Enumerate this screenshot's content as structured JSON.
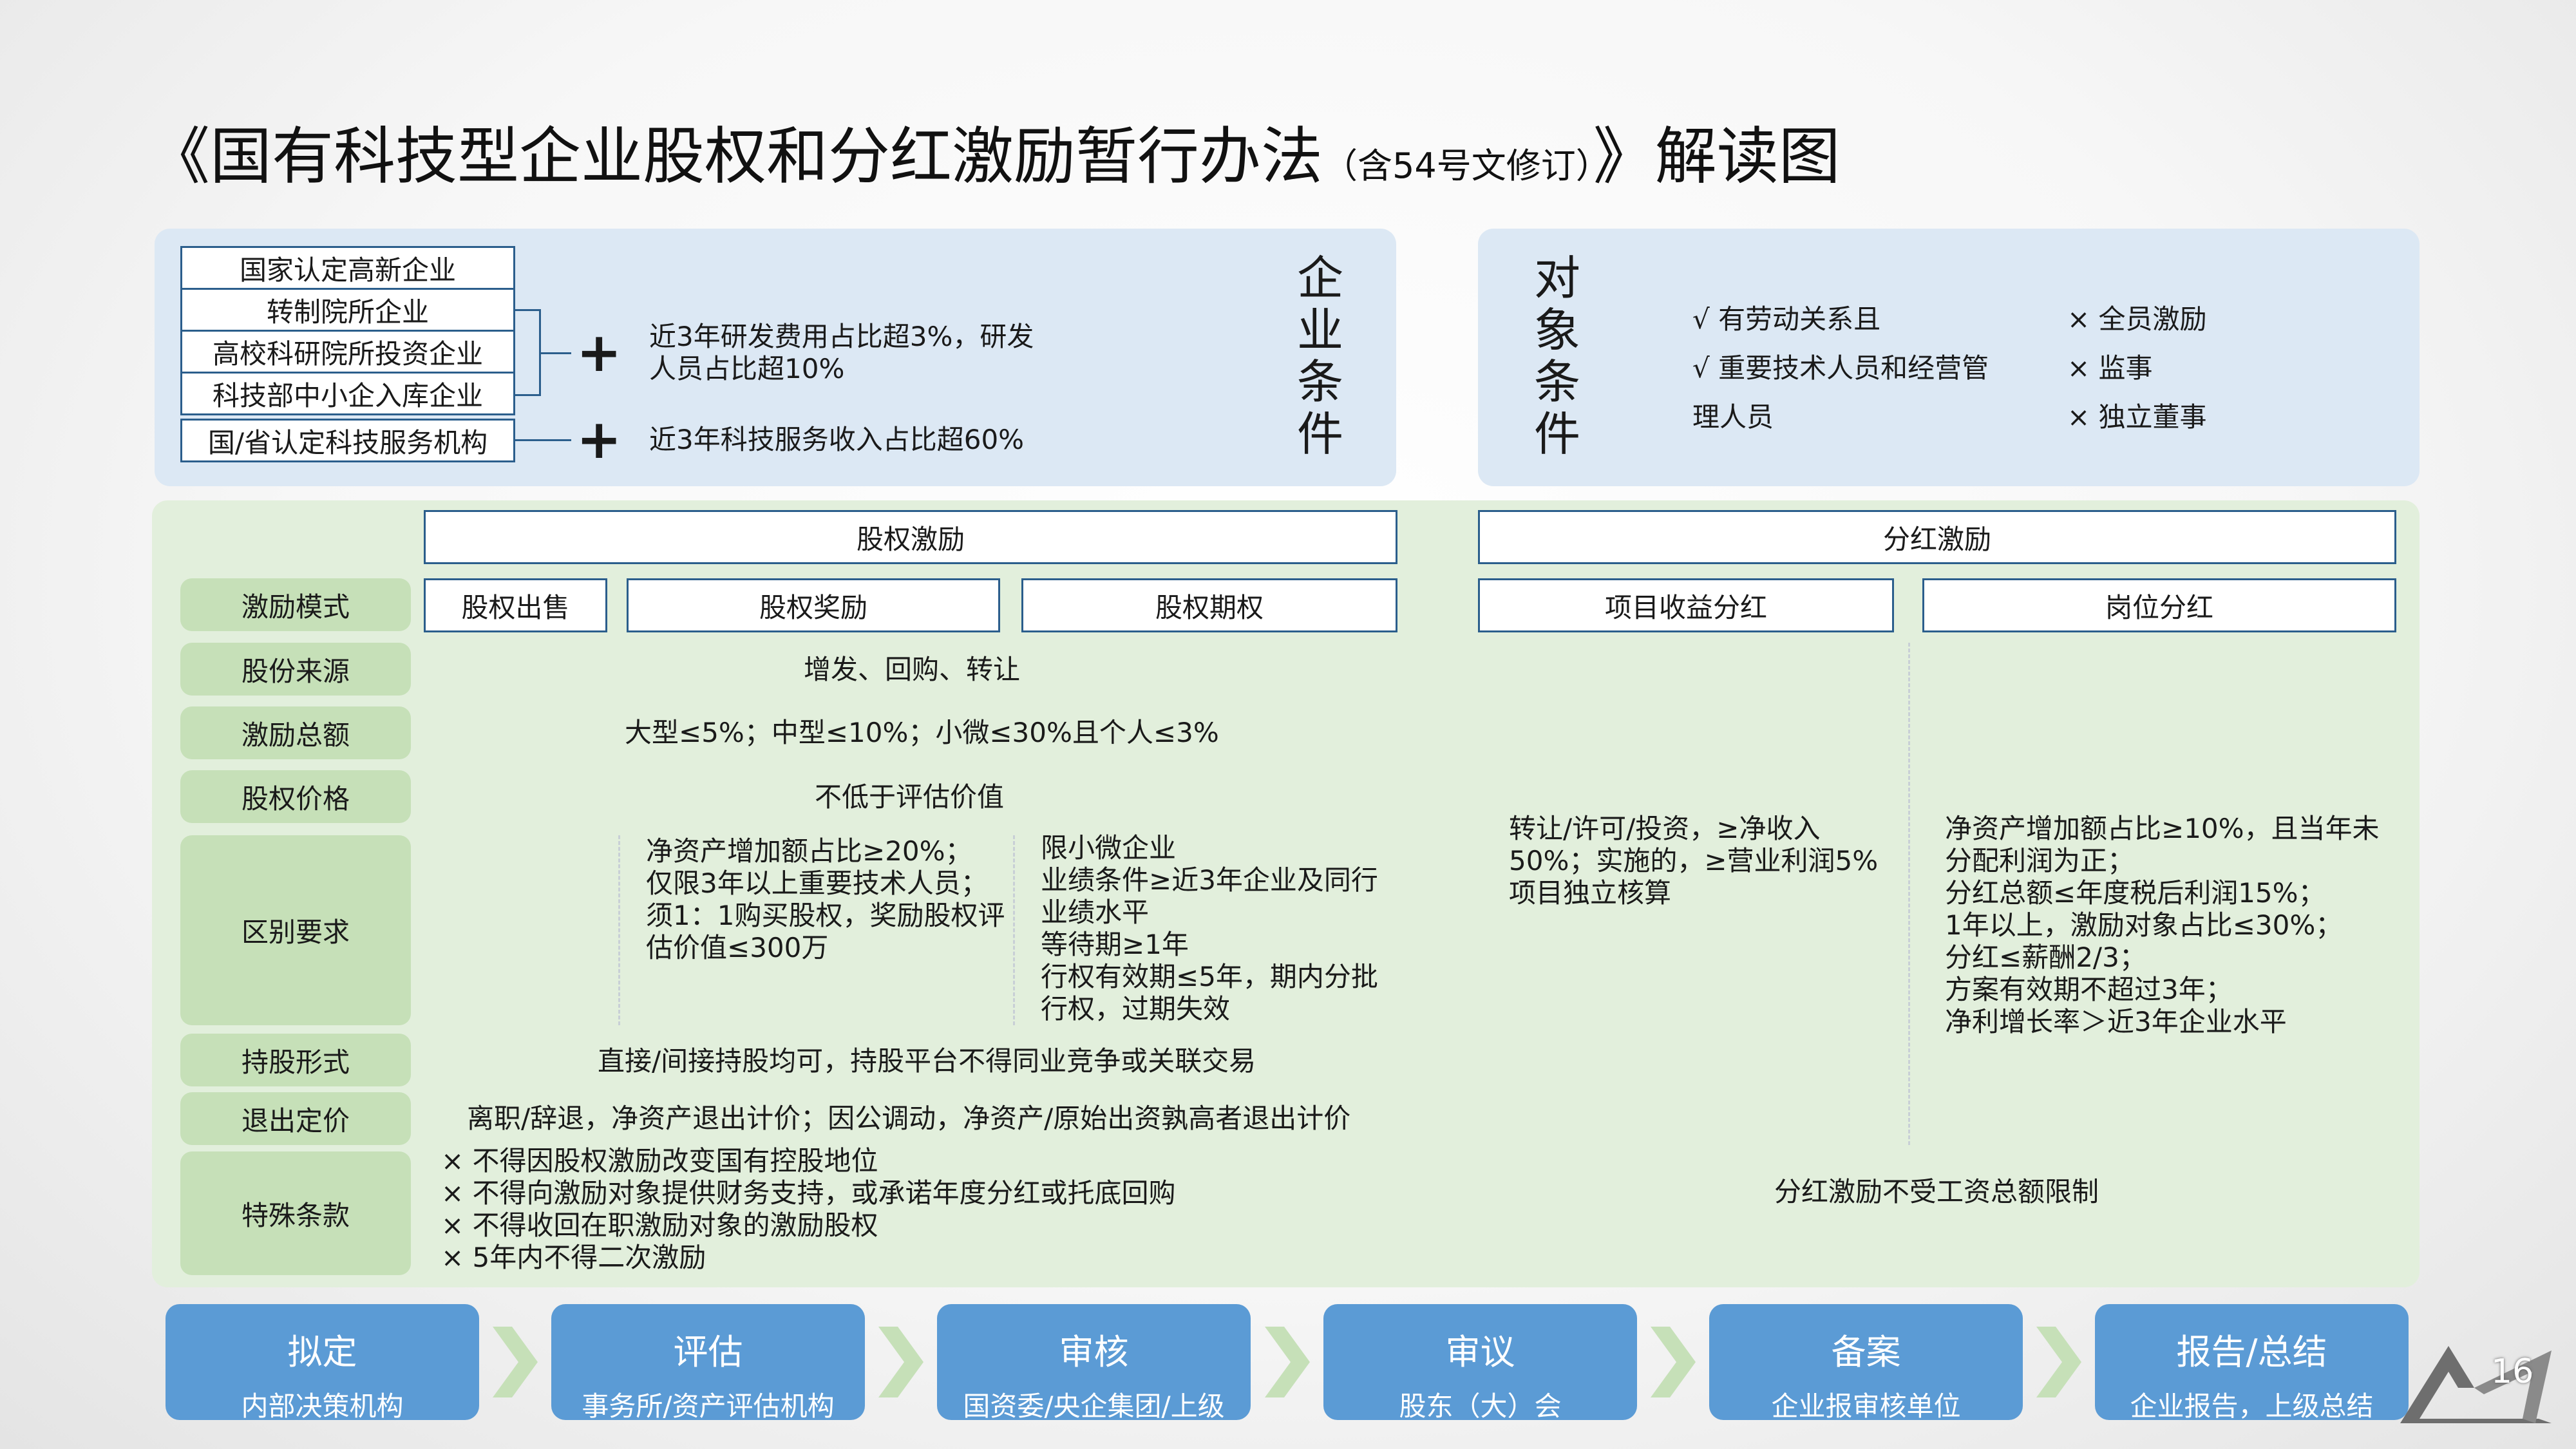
{
  "title": {
    "main": "《国有科技型企业股权和分红激励暂行办法",
    "note": "（含54号文修订）",
    "tail": "》解读图"
  },
  "enterprise": {
    "types": [
      "国家认定高新企业",
      "转制院所企业",
      "高校科研院所投资企业",
      "科技部中小企入库企业",
      "国/省认定科技服务机构"
    ],
    "plus": "+",
    "cond1": [
      "近3年研发费用占比超3%，研发",
      "人员占比超10%"
    ],
    "cond2": "近3年科技服务收入占比超60%",
    "heading": [
      "企",
      "业",
      "条",
      "件"
    ]
  },
  "target": {
    "heading": [
      "对",
      "象",
      "条",
      "件"
    ],
    "yes": [
      "√ 有劳动关系且",
      "√ 重要技术人员和经营管",
      "理人员"
    ],
    "no": [
      "× 全员激励",
      "× 监事",
      "× 独立董事"
    ]
  },
  "matrix": {
    "equity_header": "股权激励",
    "dividend_header": "分红激励",
    "row_labels": [
      "激励模式",
      "股份来源",
      "激励总额",
      "股权价格",
      "区别要求",
      "持股形式",
      "退出定价",
      "特殊条款"
    ],
    "modes": [
      "股权出售",
      "股权奖励",
      "股权期权",
      "项目收益分红",
      "岗位分红"
    ],
    "source": "增发、回购、转让",
    "total": "大型≤5%；中型≤10%；小微≤30%且个人≤3%",
    "price": "不低于评估价值",
    "req_award": [
      "净资产增加额占比≥20%；",
      "仅限3年以上重要技术人员；",
      "须1：1购买股权，奖励股权评",
      "估价值≤300万"
    ],
    "req_option": [
      "限小微企业",
      "业绩条件≥近3年企业及同行",
      "业绩水平",
      "等待期≥1年",
      "行权有效期≤5年，期内分批",
      "行权，过期失效"
    ],
    "req_project": [
      "转让/许可/投资，≥净收入",
      "50%；实施的，≥营业利润5%",
      "项目独立核算"
    ],
    "req_post": [
      "净资产增加额占比≥10%，且当年未",
      "分配利润为正；",
      "分红总额≤年度税后利润15%；",
      "1年以上，激励对象占比≤30%；",
      "分红≤薪酬2/3；",
      "方案有效期不超过3年；",
      "净利增长率＞近3年企业水平"
    ],
    "holding": "直接/间接持股均可，持股平台不得同业竞争或关联交易",
    "exit": "离职/辞退，净资产退出计价；因公调动，净资产/原始出资孰高者退出计价",
    "special": [
      "× 不得因股权激励改变国有控股地位",
      "× 不得向激励对象提供财务支持，或承诺年度分红或托底回购",
      "× 不得收回在职激励对象的激励股权",
      "× 5年内不得二次激励"
    ],
    "dividend_special": "分红激励不受工资总额限制"
  },
  "process": [
    {
      "title": "拟定",
      "sub": "内部决策机构"
    },
    {
      "title": "评估",
      "sub": "事务所/资产评估机构"
    },
    {
      "title": "审核",
      "sub": "国资委/央企集团/上级"
    },
    {
      "title": "审议",
      "sub": "股东（大）会"
    },
    {
      "title": "备案",
      "sub": "企业报审核单位"
    },
    {
      "title": "报告/总结",
      "sub": "企业报告，上级总结"
    }
  ],
  "page_number": "16",
  "colors": {
    "accent_blue": "#5b9bd5",
    "border_blue": "#2b5e8c",
    "panel_blue": "#dce8f4",
    "panel_green": "#e2efdc",
    "label_green": "#c6e0b8",
    "chevron_green": "#c6e0b8"
  }
}
